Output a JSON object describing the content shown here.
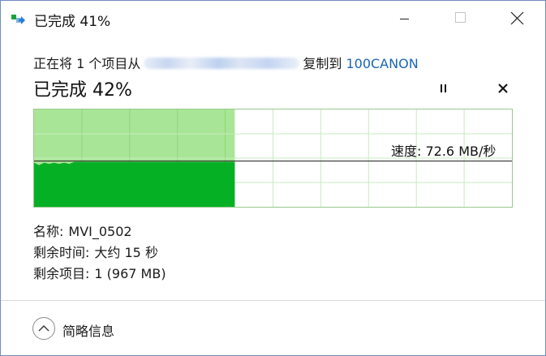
{
  "window": {
    "title": "已完成 41%",
    "icon": "copy-arrow-icon",
    "controls": {
      "minimize": "minimize-icon",
      "maximize": "maximize-icon",
      "close": "close-icon"
    }
  },
  "operation": {
    "prefix": "正在将 1 个项目从",
    "source": "",
    "copy_to": "复制到",
    "destination": "100CANON"
  },
  "progress": {
    "heading": "已完成 42%",
    "percent": 42,
    "pause_icon": "pause-icon",
    "cancel_icon": "close-icon"
  },
  "speed_graph": {
    "label": "速度: 72.6 MB/秒",
    "current_speed_mb_s": 72.6,
    "fill_color": "#06b025",
    "background_fill_color": "#a9e596",
    "grid_color": "#c9ebc1"
  },
  "details": {
    "name_label": "名称:",
    "name_value": "MVI_0502",
    "time_label": "剩余时间:",
    "time_value": "大约 15 秒",
    "items_label": "剩余项目:",
    "items_value": "1 (967 MB)"
  },
  "footer": {
    "less_info_label": "简略信息",
    "icon": "chevron-up-icon"
  }
}
